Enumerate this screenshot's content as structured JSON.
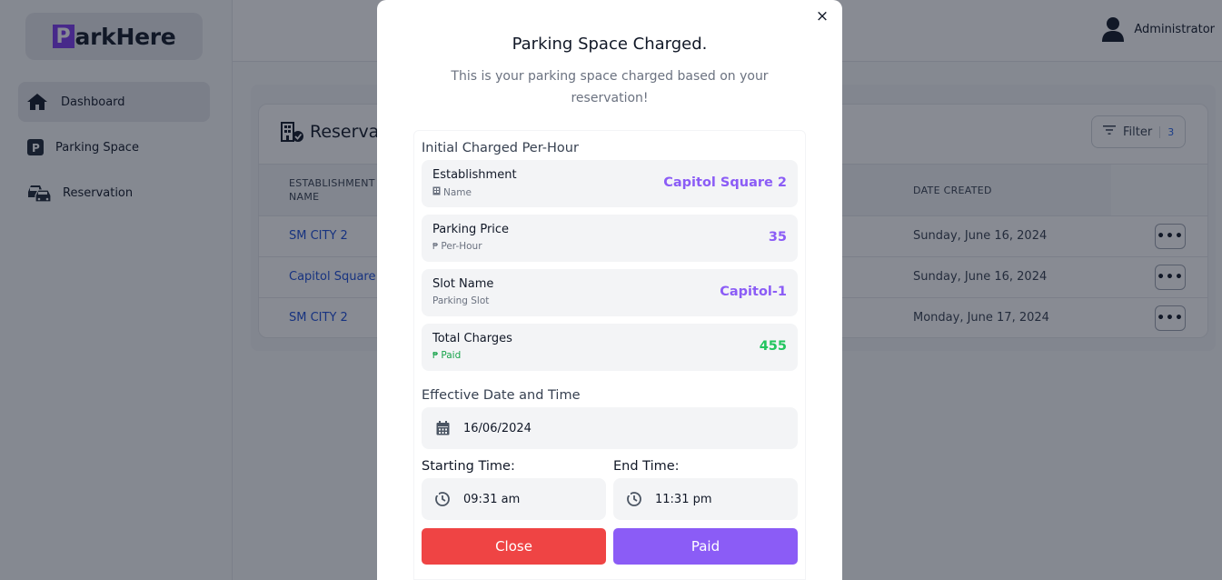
{
  "sidebar": {
    "logo_p": "P",
    "logo_rest": "arkHere",
    "items": [
      {
        "label": "Dashboard",
        "icon": "home-icon"
      },
      {
        "label": "Parking Space",
        "icon": "parking-icon"
      },
      {
        "label": "Reservation",
        "icon": "cars-icon"
      }
    ]
  },
  "header": {
    "user": "Administrator"
  },
  "table": {
    "title": "Reservati",
    "filter_label": "Filter",
    "filter_count": "3",
    "columns": {
      "establishment_line1": "ESTABLISHMENT",
      "establishment_line2": "NAME",
      "date_created": "DATE CREATED"
    },
    "rows": [
      {
        "name": "SM CITY 2",
        "date": "Sunday, June 16, 2024",
        "action": "•••"
      },
      {
        "name": "Capitol Square",
        "date": "Sunday, June 16, 2024",
        "action": "•••"
      },
      {
        "name": "SM CITY 2",
        "date": "Monday, June 17, 2024",
        "action": "•••"
      }
    ]
  },
  "modal": {
    "close_symbol": "×",
    "title": "Parking Space Charged.",
    "subtitle": "This is your parking space charged based on your reservation!",
    "section_charged": "Initial Charged Per-Hour",
    "establishment": {
      "label": "Establishment",
      "sub": "Name",
      "value": "Capitol Square 2"
    },
    "price": {
      "label": "Parking Price",
      "sub": "Per-Hour",
      "value": "35"
    },
    "slot": {
      "label": "Slot Name",
      "sub": "Parking Slot",
      "value": "Capitol-1"
    },
    "total": {
      "label": "Total Charges",
      "sub": "Paid",
      "value": "455"
    },
    "peso_symbol": "₱",
    "section_date": "Effective Date and Time",
    "date_value": "16/06/2024",
    "start_label": "Starting Time:",
    "start_value": "09:31 am",
    "end_label": "End Time:",
    "end_value": "11:31 pm",
    "close_button": "Close",
    "paid_button": "Paid"
  },
  "colors": {
    "accent": "#8b5cf6",
    "danger": "#ef4444",
    "success": "#22c55e",
    "link": "#1d4ed8"
  }
}
